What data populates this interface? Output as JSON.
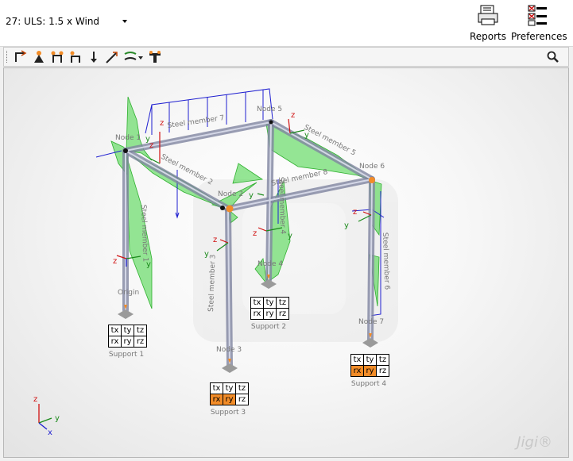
{
  "loadcase": {
    "selected": "27: ULS: 1.5 x Wind"
  },
  "toolbar_right": {
    "reports": "Reports",
    "preferences": "Preferences"
  },
  "view_tools": [
    {
      "icon": "member-tool-icon"
    },
    {
      "icon": "support-tool-icon"
    },
    {
      "icon": "frame-tool-icon"
    },
    {
      "icon": "hinge-tool-icon"
    },
    {
      "icon": "point-load-icon"
    },
    {
      "icon": "line-load-icon"
    },
    {
      "icon": "distributed-load-icon"
    },
    {
      "icon": "settings-tool-icon"
    }
  ],
  "nodes": {
    "n1": "Node 1",
    "n2": "Node 2",
    "n3": "Node 3",
    "n4": "Node 4",
    "n5": "Node 5",
    "n6": "Node 6",
    "n7": "Node 7",
    "origin": "Origin"
  },
  "members": {
    "m1": "Steel member 1",
    "m2": "Steel member 2",
    "m3": "Steel member 3",
    "m4": "Steel member 4",
    "m5": "Steel member 5",
    "m6": "Steel member 6",
    "m7": "Steel member 7",
    "m8": "Steel member 8"
  },
  "supports": [
    {
      "label": "Support 1",
      "dof": [
        [
          "tx",
          "ty",
          "tz"
        ],
        [
          "rx",
          "ry",
          "rz"
        ]
      ],
      "fixed": []
    },
    {
      "label": "Support 2",
      "dof": [
        [
          "tx",
          "ty",
          "tz"
        ],
        [
          "rx",
          "ry",
          "rz"
        ]
      ],
      "fixed": []
    },
    {
      "label": "Support 3",
      "dof": [
        [
          "tx",
          "ty",
          "tz"
        ],
        [
          "rx",
          "ry",
          "rz"
        ]
      ],
      "fixed": [
        "rx",
        "ry"
      ]
    },
    {
      "label": "Support 4",
      "dof": [
        [
          "tx",
          "ty",
          "tz"
        ],
        [
          "rx",
          "ry",
          "rz"
        ]
      ],
      "fixed": [
        "rx",
        "ry"
      ]
    }
  ],
  "axes": {
    "x": "x",
    "y": "y",
    "z": "z"
  },
  "brand": "Jigi",
  "colors": {
    "diagram": "#3fd33f",
    "load": "#1f1fd0",
    "fixed": "#f28c28",
    "member": "#8a8fa8"
  }
}
